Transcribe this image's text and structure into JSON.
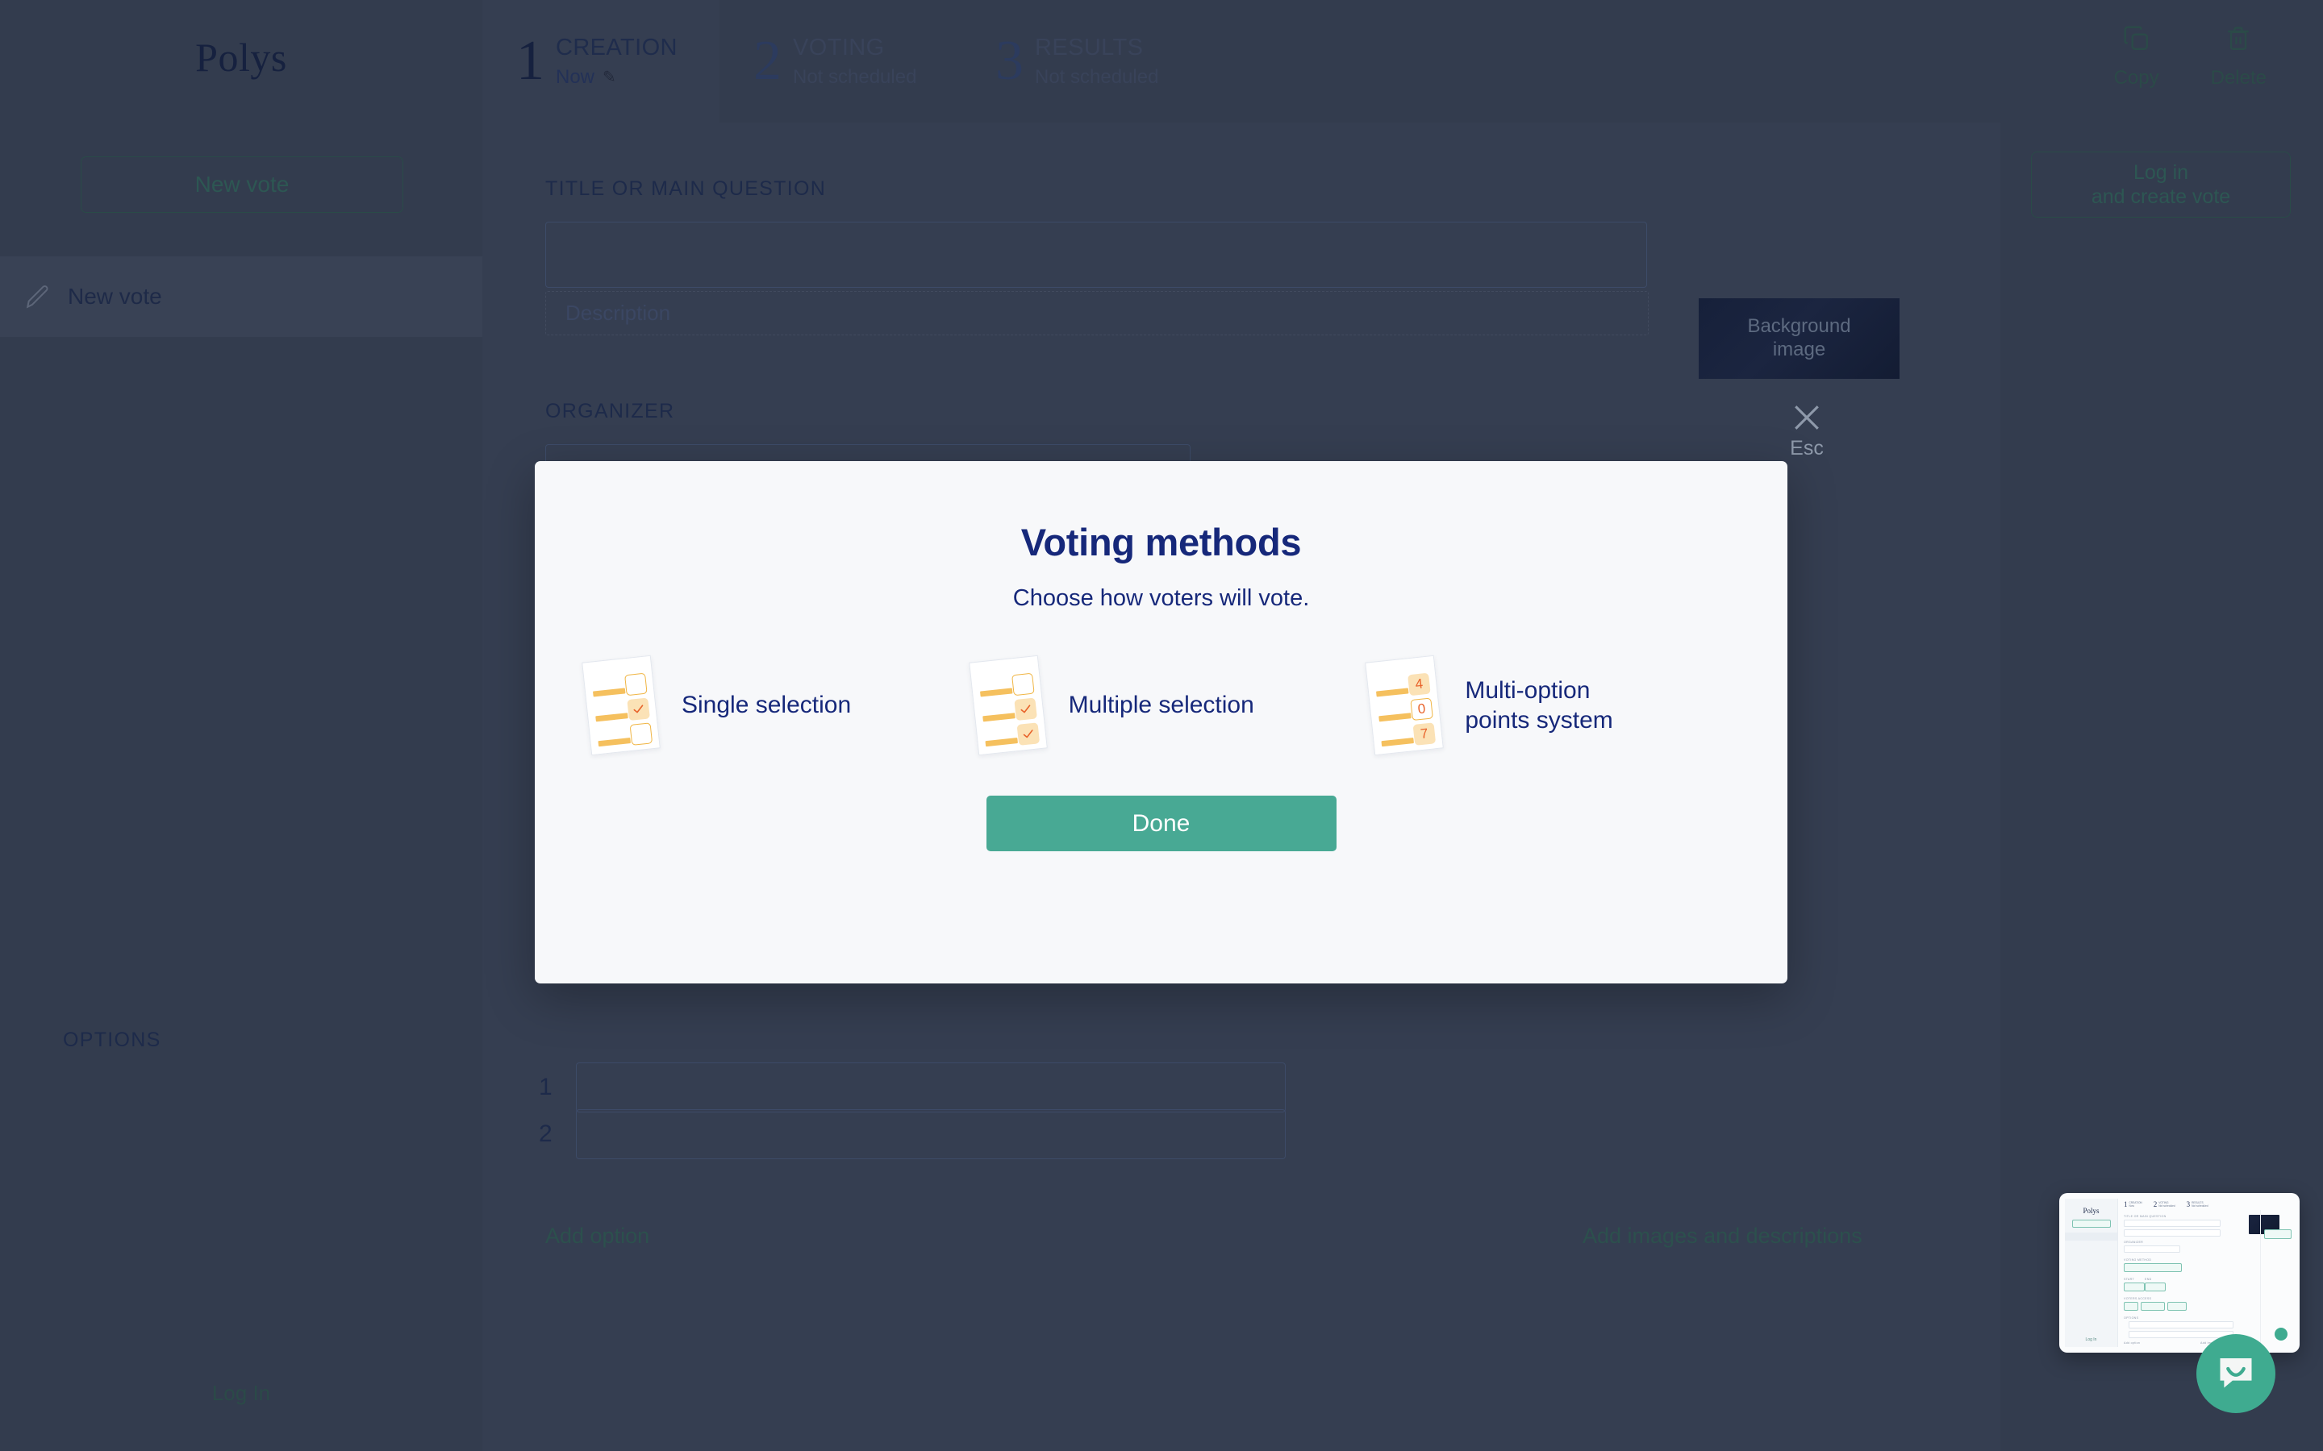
{
  "sidebar": {
    "brand": "Polys",
    "new_vote_button": "New vote",
    "items": [
      {
        "label": "New vote",
        "icon": "pencil-icon"
      }
    ],
    "login_link": "Log In"
  },
  "steps": [
    {
      "number": "1",
      "name": "CREATION",
      "status": "Now",
      "icon": "pencil-emoji",
      "active": true
    },
    {
      "number": "2",
      "name": "VOTING",
      "status": "Not scheduled",
      "active": false
    },
    {
      "number": "3",
      "name": "RESULTS",
      "status": "Not scheduled",
      "active": false
    }
  ],
  "top_actions": [
    {
      "label": "Copy",
      "icon": "copy-icon"
    },
    {
      "label": "Delete",
      "icon": "trash-icon"
    }
  ],
  "form": {
    "title_label": "TITLE OR MAIN QUESTION",
    "title_value": "",
    "description_placeholder": "Description",
    "background_image_label": "Background\nimage",
    "background_image_line1": "Background",
    "background_image_line2": "image",
    "organizer_label": "ORGANIZER",
    "organizer_value": "",
    "options_label": "OPTIONS",
    "options": [
      {
        "index": "1",
        "value": ""
      },
      {
        "index": "2",
        "value": ""
      }
    ],
    "add_option": "Add option",
    "add_images": "Add images and descriptions"
  },
  "right_rail": {
    "login_create_line1": "Log in",
    "login_create_line2": "and create vote"
  },
  "close": {
    "label": "Esc",
    "icon": "close-x-icon"
  },
  "modal": {
    "title": "Voting methods",
    "subtitle": "Choose how voters will vote.",
    "methods": [
      {
        "label": "Single selection",
        "icon": "checklist-single-icon",
        "checkboxes": [
          "empty",
          "checked",
          "empty"
        ]
      },
      {
        "label": "Multiple selection",
        "icon": "checklist-multiple-icon",
        "checkboxes": [
          "empty",
          "checked",
          "checked"
        ]
      },
      {
        "label_line1": "Multi-option",
        "label_line2": "points system",
        "label": "Multi-option points system",
        "icon": "checklist-points-icon",
        "points": [
          "4",
          "0",
          "7"
        ]
      }
    ],
    "done_button": "Done"
  },
  "chat_widget": {
    "icon": "chat-bubble-icon",
    "thumbnail_brand": "Polys",
    "thumbnail_login": "Log In"
  },
  "colors": {
    "app_background": "#333c4e",
    "panel_background": "#353e51",
    "modal_background": "#f7f8fa",
    "accent_navy": "#16287a",
    "accent_green": "#48a994",
    "chat_green": "#3fab90",
    "checklist_yellow": "#f5c05e",
    "tick_orange": "#e8622a",
    "muted_teal": "#2d5753"
  }
}
